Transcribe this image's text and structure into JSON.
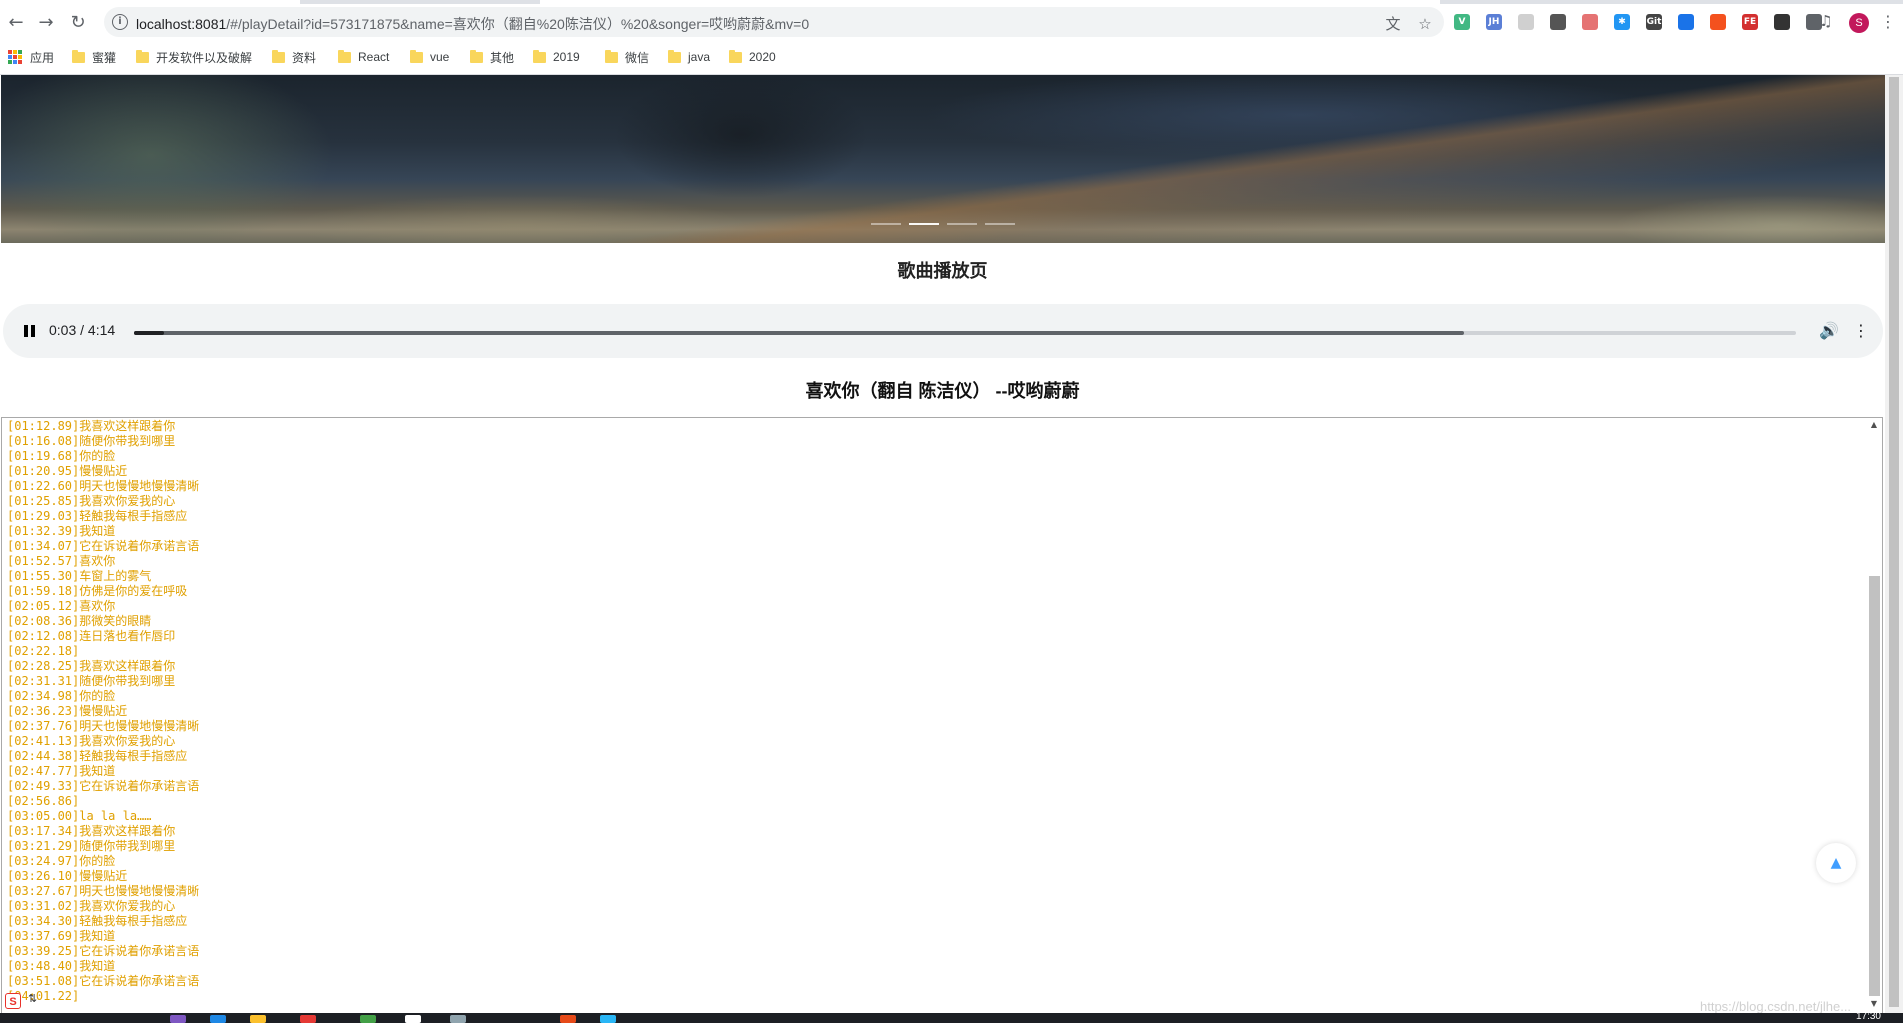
{
  "browser": {
    "url_host": "localhost:8081",
    "url_path": "/#/playDetail?id=573171875&name=喜欢你（翻自%20陈洁仪）%20&songer=哎哟蔚蔚&mv=0",
    "back_icon": "back-arrow-icon",
    "forward_icon": "forward-arrow-icon",
    "reload_icon": "reload-icon",
    "bookmarks": [
      {
        "label": "应用",
        "icon": "apps-icon"
      },
      {
        "label": "蜜獾",
        "icon": "folder-icon"
      },
      {
        "label": "开发软件以及破解",
        "icon": "folder-icon"
      },
      {
        "label": "资料",
        "icon": "folder-icon"
      },
      {
        "label": "React",
        "icon": "folder-icon"
      },
      {
        "label": "vue",
        "icon": "folder-icon"
      },
      {
        "label": "其他",
        "icon": "folder-icon"
      },
      {
        "label": "2019",
        "icon": "folder-icon"
      },
      {
        "label": "微信",
        "icon": "folder-icon"
      },
      {
        "label": "java",
        "icon": "folder-icon"
      },
      {
        "label": "2020",
        "icon": "folder-icon"
      }
    ],
    "extensions": [
      {
        "text": "V",
        "color": "#41b883"
      },
      {
        "text": "JH",
        "color": "#5b7fd6"
      },
      {
        "text": "",
        "color": "#d0d0d0"
      },
      {
        "text": "",
        "color": "#555555"
      },
      {
        "text": "",
        "color": "#e57373"
      },
      {
        "text": "✱",
        "color": "#2196f3"
      },
      {
        "text": "Git",
        "color": "#444444"
      },
      {
        "text": "",
        "color": "#1a73e8"
      },
      {
        "text": "",
        "color": "#f4511e"
      },
      {
        "text": "FE",
        "color": "#d32f2f"
      },
      {
        "text": "",
        "color": "#333333"
      },
      {
        "text": "",
        "color": "#5f6368"
      }
    ],
    "profile_initial": "S"
  },
  "carousel": {
    "slide_count": 4,
    "active_index": 1
  },
  "page": {
    "title": "歌曲播放页",
    "song_title": "喜欢你（翻自 陈洁仪） --哎哟蔚蔚"
  },
  "player": {
    "time": "0:03 / 4:14",
    "played_fraction": 0.018,
    "buffered_fraction": 0.8,
    "state": "playing",
    "pause_icon": "pause-icon",
    "volume_icon": "volume-icon",
    "more_icon": "more-vertical-icon"
  },
  "lyrics": [
    "[01:12.89]我喜欢这样跟着你",
    "[01:16.08]随便你带我到哪里",
    "[01:19.68]你的脸",
    "[01:20.95]慢慢贴近",
    "[01:22.60]明天也慢慢地慢慢清晰",
    "[01:25.85]我喜欢你爱我的心",
    "[01:29.03]轻触我每根手指感应",
    "[01:32.39]我知道",
    "[01:34.07]它在诉说着你承诺言语",
    "[01:52.57]喜欢你",
    "[01:55.30]车窗上的雾气",
    "[01:59.18]仿佛是你的爱在呼吸",
    "[02:05.12]喜欢你",
    "[02:08.36]那微笑的眼睛",
    "[02:12.08]连日落也看作唇印",
    "[02:22.18]",
    "[02:28.25]我喜欢这样跟着你",
    "[02:31.31]随便你带我到哪里",
    "[02:34.98]你的脸",
    "[02:36.23]慢慢贴近",
    "[02:37.76]明天也慢慢地慢慢清晰",
    "[02:41.13]我喜欢你爱我的心",
    "[02:44.38]轻触我每根手指感应",
    "[02:47.77]我知道",
    "[02:49.33]它在诉说着你承诺言语",
    "[02:56.86]",
    "[03:05.00]la la la……",
    "[03:17.34]我喜欢这样跟着你",
    "[03:21.29]随便你带我到哪里",
    "[03:24.97]你的脸",
    "[03:26.10]慢慢贴近",
    "[03:27.67]明天也慢慢地慢慢清晰",
    "[03:31.02]我喜欢你爱我的心",
    "[03:34.30]轻触我每根手指感应",
    "[03:37.69]我知道",
    "[03:39.25]它在诉说着你承诺言语",
    "[03:48.40]我知道",
    "[03:51.08]它在诉说着你承诺言语",
    "[04:01.22]"
  ],
  "back_to_top_icon": "caret-up-icon",
  "watermark": "https://blog.csdn.net/jlhe...",
  "taskbar_time": "17:30",
  "ime_label": "S"
}
